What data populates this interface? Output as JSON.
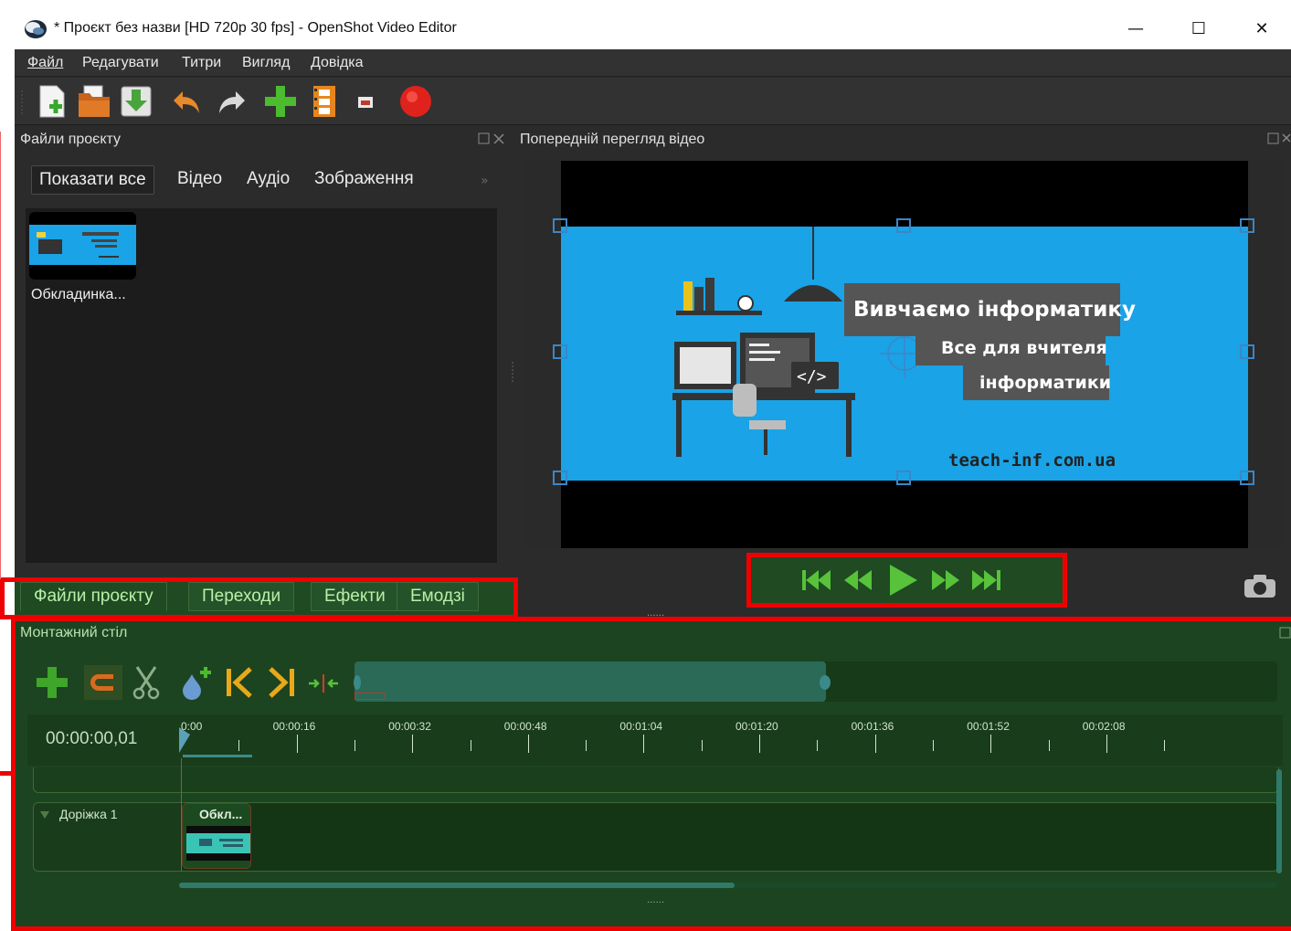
{
  "window": {
    "title": "* Проєкт без назви [HD 720p 30 fps] - OpenShot Video Editor",
    "controls": {
      "minimize": "—",
      "maximize": "☐",
      "close": "✕"
    }
  },
  "menu": [
    "Файл",
    "Редагувати",
    "Титри",
    "Вигляд",
    "Довідка"
  ],
  "toolbar_icons": [
    "new-project-icon",
    "open-project-icon",
    "save-project-icon",
    "undo-icon",
    "redo-icon",
    "import-files-icon",
    "choose-profile-icon",
    "fullscreen-icon",
    "export-video-icon"
  ],
  "files_panel": {
    "title": "Файли проєкту",
    "filters": [
      "Показати все",
      "Відео",
      "Аудіо",
      "Зображення"
    ],
    "more": "»",
    "items": [
      {
        "name": "Обкладинка..."
      }
    ]
  },
  "bottom_tabs": [
    "Файли проєкту",
    "Переходи",
    "Ефекти",
    "Емодзі"
  ],
  "preview": {
    "title": "Попередній перегляд відео",
    "frame_text": {
      "heading": "Вивчаємо інформатику",
      "line1": "Все для вчителя",
      "line2": "інформатики",
      "site": "teach-inf.com.ua",
      "code_tag": "</>"
    }
  },
  "playback": [
    "jump-start-icon",
    "rewind-icon",
    "play-icon",
    "fast-forward-icon",
    "jump-end-icon"
  ],
  "timeline": {
    "title": "Монтажний стіл",
    "timecode": "00:00:00,01",
    "ticks": [
      "0:00",
      "00:00:16",
      "00:00:32",
      "00:00:48",
      "00:01:04",
      "00:01:20",
      "00:01:36",
      "00:01:52",
      "00:02:08"
    ],
    "track_label": "Доріжка 1",
    "clip_label": "Обкл...",
    "resize_grip": "......"
  },
  "colors": {
    "dark_bg": "#2b2b2b",
    "green_overlay": "#1d4420",
    "highlight_red": "#ee0000",
    "preview_blue": "#1aa3e6"
  }
}
